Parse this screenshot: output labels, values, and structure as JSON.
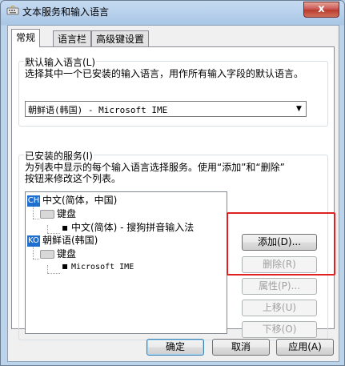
{
  "window": {
    "title": "文本服务和输入语言",
    "close_glyph": "x"
  },
  "tabs": [
    {
      "label": "常规"
    },
    {
      "label": "语言栏"
    },
    {
      "label": "高级键设置"
    }
  ],
  "default_language": {
    "title": "默认输入语言(L)",
    "description": "选择其中一个已安装的输入语言，用作所有输入字段的默认语言。",
    "selected": "朝鲜语(韩国) - Microsoft IME"
  },
  "installed_services": {
    "title": "已安装的服务(I)",
    "description_line1": "为列表中显示的每个输入语言选择服务。使用“添加”和“删除”",
    "description_line2": "按钮来修改这个列表。",
    "tree": [
      {
        "code": "CH",
        "language": "中文(简体，中国)",
        "category": "键盘",
        "service": "中文(简体) - 搜狗拼音输入法"
      },
      {
        "code": "KO",
        "language": "朝鲜语(韩国)",
        "category": "键盘",
        "service": "Microsoft IME"
      }
    ],
    "buttons": {
      "add": "添加(D)...",
      "remove": "删除(R)",
      "properties": "属性(P)...",
      "move_up": "上移(U)",
      "move_down": "下移(O)"
    }
  },
  "dialog_buttons": {
    "ok": "确定",
    "cancel": "取消",
    "apply": "应用(A)"
  },
  "colors": {
    "highlight_box": "#e02020",
    "language_icon": "#1e6fd0"
  }
}
